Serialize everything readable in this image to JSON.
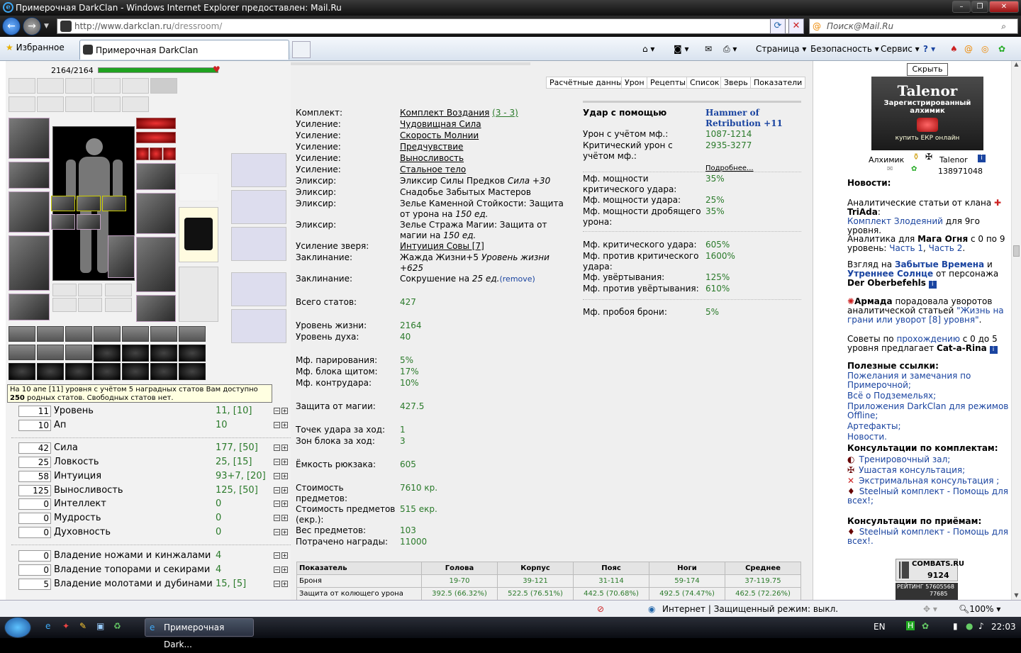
{
  "window": {
    "title": "Примерочная DarkClan - Windows Internet Explorer предоставлен: Mail.Ru"
  },
  "browser": {
    "url_host": "http://www.darkclan.ru",
    "url_path": "/dressroom/",
    "search_placeholder": "Поиск@Mail.Ru",
    "favorites": "Избранное",
    "tab_title": "Примерочная DarkClan",
    "commands": [
      "Страница",
      "Безопасность",
      "Сервис"
    ]
  },
  "hp": {
    "text": "2164/2164",
    "fraction": 1.0
  },
  "tooltip": {
    "part1": "На 10 апе [11] уровня с учётом 5 наградных статов Вам доступно ",
    "bold": "250",
    "part2": " родных статов. Свободных статов нет."
  },
  "level_rows": [
    {
      "num": "11",
      "name": "Уровень",
      "value": "11, [10]"
    },
    {
      "num": "10",
      "name": "Ап",
      "value": "10"
    }
  ],
  "stat_rows": [
    {
      "num": "42",
      "name": "Сила",
      "value": "177, [50]"
    },
    {
      "num": "25",
      "name": "Ловкость",
      "value": "25, [15]"
    },
    {
      "num": "58",
      "name": "Интуиция",
      "value": "93+7, [20]"
    },
    {
      "num": "125",
      "name": "Выносливость",
      "value": "125, [50]"
    },
    {
      "num": "0",
      "name": "Интеллект",
      "value": "0"
    },
    {
      "num": "0",
      "name": "Мудрость",
      "value": "0"
    },
    {
      "num": "0",
      "name": "Духовность",
      "value": "0"
    }
  ],
  "skill_rows": [
    {
      "num": "0",
      "name": "Владение ножами и кинжалами",
      "value": "4"
    },
    {
      "num": "0",
      "name": "Владение топорами и секирами",
      "value": "4"
    },
    {
      "num": "5",
      "name": "Владение молотами и дубинами",
      "value": "15, [5]"
    }
  ],
  "tabs": [
    "Расчётные данные",
    "Урон",
    "Рецепты",
    "Список",
    "Зверь",
    "Показатели"
  ],
  "mid": {
    "set_label": "Комплект:",
    "set_link": "Комплект Воздания",
    "set_count": "(3 - 3)",
    "boosts": [
      {
        "label": "Усиление:",
        "value": "Чудовищная Сила"
      },
      {
        "label": "Усиление:",
        "value": "Скорость Молнии"
      },
      {
        "label": "Усиление:",
        "value": "Предчувствие"
      },
      {
        "label": "Усиление:",
        "value": "Выносливость"
      },
      {
        "label": "Усиление:",
        "value": "Стальное тело"
      }
    ],
    "elixir1_label": "Эликсир:",
    "elixir1_a": "Эликсир Силы Предков ",
    "elixir1_b": "Сила +30",
    "elixir2_label": "Эликсир:",
    "elixir2": "Снадобье Забытых Мастеров",
    "elixir3_label": "Эликсир:",
    "elixir3_a": "Зелье Каменной Стойкости: Защита от урона на ",
    "elixir3_b": "150 ед.",
    "elixir4_label": "Эликсир:",
    "elixir4_a": "Зелье Стража Магии: Защита от магии на ",
    "elixir4_b": "150 ед.",
    "beast_label": "Усиление зверя:",
    "beast": "Интуиция Совы [7]",
    "spell1_label": "Заклинание:",
    "spell1_a": "Жажда Жизни+5 ",
    "spell1_b": "Уровень жизни +625",
    "spell2_label": "Заклинание:",
    "spell2_a": "Сокрушение на ",
    "spell2_b": "25 ед.",
    "spell2_remove": "(remove)",
    "total_label": "Всего статов:",
    "total": "427",
    "life_label": "Уровень жизни:",
    "life": "2164",
    "spirit_label": "Уровень духа:",
    "spirit": "40",
    "parry_label": "Мф. парирования:",
    "parry": "5%",
    "block_label": "Мф. блока щитом:",
    "block": "17%",
    "counter_label": "Мф. контрудара:",
    "counter": "10%",
    "magic_label": "Защита от магии:",
    "magic": "427.5",
    "hitpts_label": "Точек удара за ход:",
    "hitpts": "1",
    "blockz_label": "Зон блока за ход:",
    "blockz": "3",
    "bag_label": "Ёмкость рюкзака:",
    "bag": "605",
    "cost_label": "Стоимость предметов:",
    "cost": "7610 кр.",
    "ecost_label": "Стоимость предметов (екр.):",
    "ecost": "515 екр.",
    "weight_label": "Вес предметов:",
    "weight": "103",
    "award_label": "Потрачено награды:",
    "award": "11000",
    "weapon_label": "Удар с помощью",
    "weapon": "Hammer of Retribution +11",
    "dmg_label": "Урон с учётом мф.:",
    "dmg": "1087-1214",
    "crit_label": "Критический урон с учётом мф.:",
    "crit": "2935-3277",
    "more": "Подробнее...",
    "pcrit_label": "Мф. мощности критического удара:",
    "pcrit": "35%",
    "phit_label": "Мф. мощности удара:",
    "phit": "25%",
    "pcrush_label": "Мф. мощности дробящего урона:",
    "pcrush": "35%",
    "mcrit_label": "Мф. критического удара:",
    "mcrit": "605%",
    "macrit_label": "Мф. против критического удара:",
    "macrit": "1600%",
    "dodge_label": "Мф. увёртывания:",
    "dodge": "125%",
    "adodge_label": "Мф. против увёртывания:",
    "adodge": "610%",
    "pierce_label": "Мф. пробоя брони:",
    "pierce": "5%"
  },
  "table": {
    "headers": [
      "Показатель",
      "Голова",
      "Корпус",
      "Пояс",
      "Ноги",
      "Среднее"
    ],
    "rows": [
      [
        "Броня",
        "19-70",
        "39-121",
        "31-114",
        "59-174",
        "37-119.75"
      ],
      [
        "Защита от колющего урона",
        "392.5 (66.32%)",
        "522.5 (76.51%)",
        "442.5 (70.68%)",
        "492.5 (74.47%)",
        "462.5 (72.26%)"
      ]
    ]
  },
  "right": {
    "hide": "Скрыть",
    "banner_title": "Talenor",
    "banner_sub": "Зарегистрированный алхимик",
    "banner_buy": "купить ЕКР онлайн",
    "role": "Алхимик",
    "nick": "Talenor",
    "icq": "138971048",
    "news_title": "Новости:",
    "n1a": "Аналитические статьи от клана ",
    "n1b": "TriAda",
    "n1c": ":",
    "n1link": "Комплект Злодеяний",
    "n1d": " для 9го уровня.",
    "n2a": "Аналитика для ",
    "n2b": "Мага Огня",
    "n2c": " с 0 по 9 уровень: ",
    "n2l1": "Часть 1",
    "n2d": ", ",
    "n2l2": "Часть 2",
    "n2e": ".",
    "n3a": "Взгляд на ",
    "n3l1": "Забытые Времена",
    "n3b": " и ",
    "n3l2": "Утреннее Солнце",
    "n3c": " от персонажа ",
    "n3d": "Der Oberbefehls",
    "n4a": "Армада",
    "n4b": " порадовала уворотов аналитической статьей ",
    "n4l": "\"Жизнь на грани или уворот [8] уровня\"",
    "n4c": ".",
    "n5a": "Советы по ",
    "n5l": "прохождению",
    "n5b": " с 0 до 5 уровня предлагает ",
    "n5c": "Cat-a-Rina",
    "useful_title": "Полезные ссылки:",
    "useful": [
      "Пожелания и замечания по Примерочной;",
      "Всё о Подземельях;",
      "Приложения DarkClan для режимов Offline;",
      "Артефакты;",
      "Новости."
    ],
    "consult_title": "Консультации по комплектам:",
    "consult": [
      "Тренировочный зал;",
      "Ушастая консультация;",
      "Экстримальная консультация ;",
      "Steelный комплект - Помощь для всех!;"
    ],
    "consult2_title": "Консультации по приёмам:",
    "consult2": [
      "Steelный комплект - Помощь для всех!."
    ],
    "counter_label": "COMBATS.RU",
    "counter_num": "9124",
    "rating_label": "РЕЙТИНГ",
    "rating_a": "57605568",
    "rating_b": "77685"
  },
  "status": {
    "zone": "Интернет | Защищенный режим: выкл.",
    "zoom": "100%"
  },
  "taskbar": {
    "item": "Примерочная Dark...",
    "lang": "EN",
    "time": "22:03"
  },
  "colors": {
    "hp_green": "#1fa21f",
    "link_blue": "#1a44a0",
    "value_green": "#2a7a2a"
  }
}
